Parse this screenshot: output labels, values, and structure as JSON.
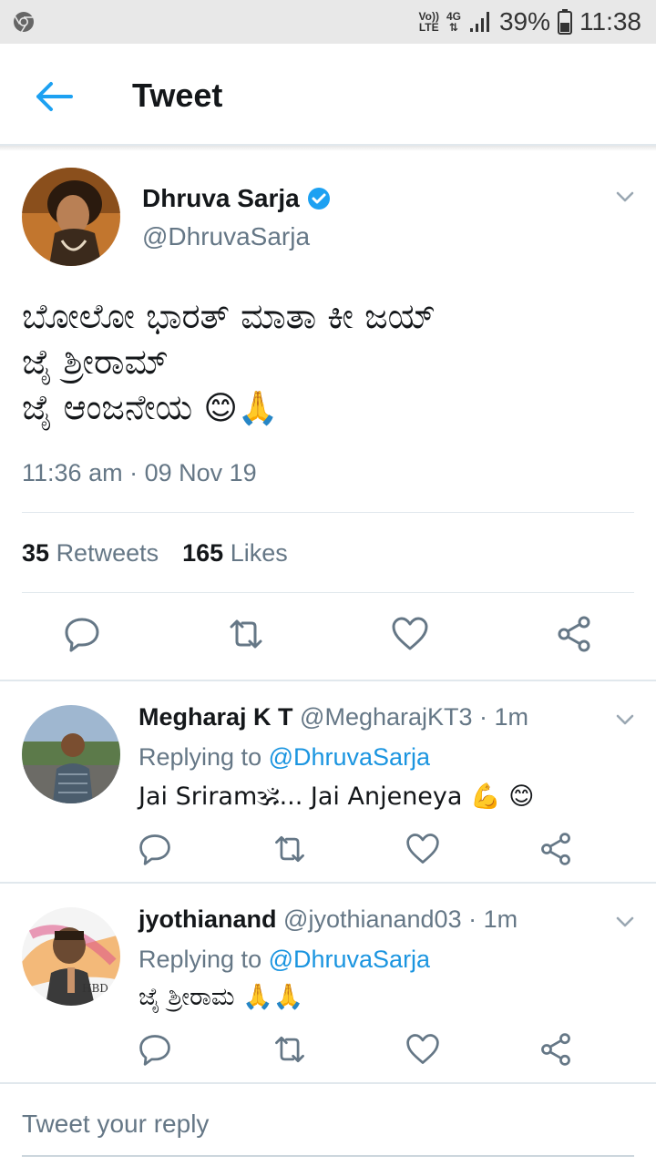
{
  "status_bar": {
    "volte_top": "Vo))",
    "volte_bottom": "LTE",
    "network": "4G",
    "battery": "39%",
    "time": "11:38"
  },
  "header": {
    "title": "Tweet"
  },
  "main_tweet": {
    "name": "Dhruva Sarja",
    "handle": "@DhruvaSarja",
    "text_lines": [
      "ಬೋಲೋ ಭಾರತ್ ಮಾತಾ ಕೀ ಜಯ್",
      "ಜೈ ಶ್ರೀರಾಮ್",
      "ಜೈ ಆಂಜನೇಯ"
    ],
    "line3_emojis": "😊🙏",
    "timestamp": "11:36 am · 09 Nov 19",
    "retweets_count": "35",
    "retweets_label": "Retweets",
    "likes_count": "165",
    "likes_label": "Likes"
  },
  "replies": [
    {
      "name": "Megharaj K T",
      "handle": "@MegharajKT3",
      "time": " · 1m",
      "replying_prefix": "Replying to ",
      "replying_to": "@DhruvaSarja",
      "text": "Jai Sriram🕉... Jai Anjeneya 💪 😊"
    },
    {
      "name": "jyothianand",
      "handle": "@jyothianand03",
      "time": " · 1m",
      "replying_prefix": "Replying to ",
      "replying_to": "@DhruvaSarja",
      "text": "ಜೈ ಶ್ರೀರಾಮ 🙏🙏",
      "avatar_text": "HBD"
    }
  ],
  "compose": {
    "placeholder": "Tweet your reply"
  },
  "colors": {
    "accent": "#1da1f2",
    "link": "#1b95e0",
    "secondary_text": "#657786",
    "verified": "#1da1f2",
    "status_bar_bg": "#e8e8e8"
  },
  "icons": {
    "back": "arrow-left-icon",
    "verified": "verified-badge-icon",
    "reply": "reply-icon",
    "retweet": "retweet-icon",
    "like": "heart-icon",
    "share": "share-icon",
    "more": "chevron-down-icon"
  }
}
